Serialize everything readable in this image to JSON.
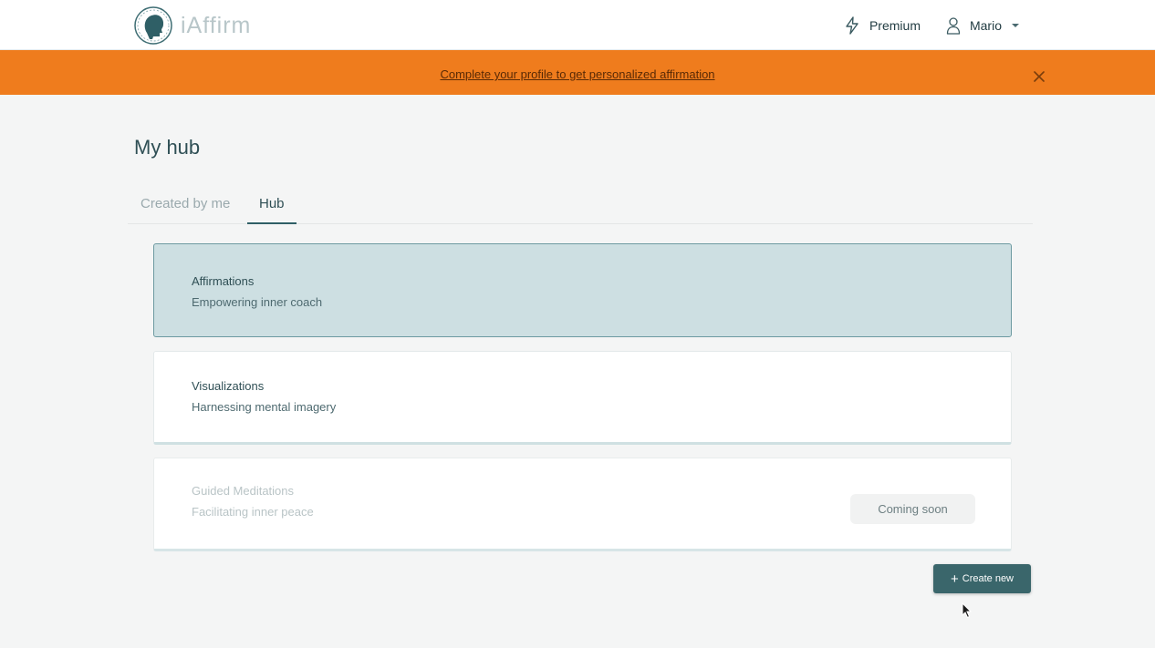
{
  "header": {
    "logo_text": "iAffirm",
    "premium_label": "Premium",
    "user_name": "Mario"
  },
  "banner": {
    "message": "Complete your profile to get personalized affirmation",
    "color": "#ef7c1d"
  },
  "page": {
    "title": "My hub"
  },
  "tabs": [
    {
      "label": "Created by me",
      "active": false
    },
    {
      "label": "Hub",
      "active": true
    }
  ],
  "cards": [
    {
      "title": "Affirmations",
      "subtitle": "Empowering inner coach",
      "selected": true
    },
    {
      "title": "Visualizations",
      "subtitle": "Harnessing mental imagery",
      "selected": false
    },
    {
      "title": "Guided Meditations",
      "subtitle": "Facilitating inner peace",
      "badge": "Coming soon",
      "disabled": true
    }
  ],
  "actions": {
    "create_new_label": "Create new"
  },
  "icons": {
    "premium": "lightning-icon",
    "user": "user-icon",
    "dropdown": "caret-down-icon",
    "close": "close-icon",
    "plus": "plus-icon"
  },
  "colors": {
    "accent": "#3a666b",
    "selected_card": "#cddfe2",
    "banner": "#ef7c1d"
  }
}
